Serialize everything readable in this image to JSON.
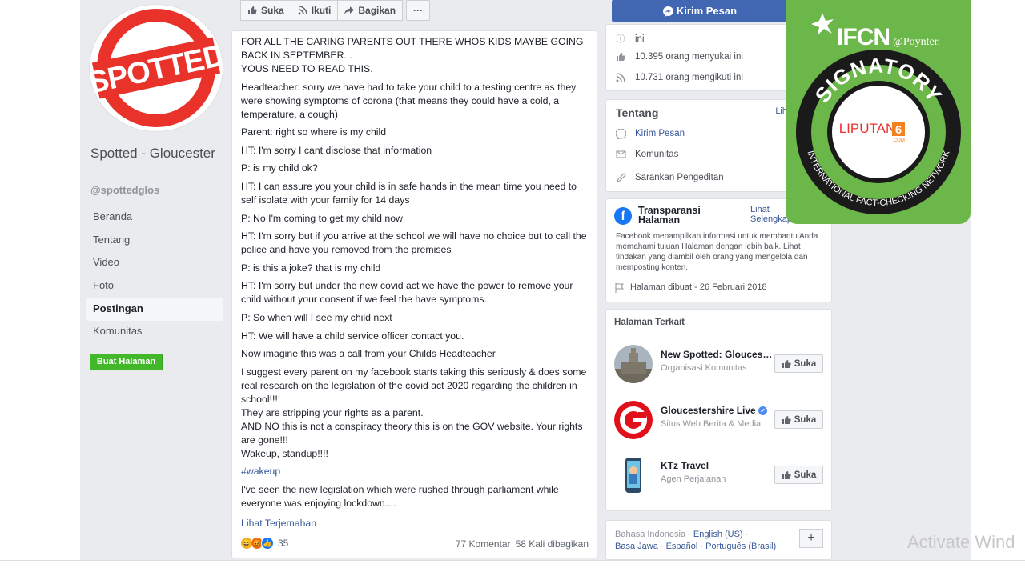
{
  "page": {
    "name": "Spotted - Gloucester",
    "handle": "@spottedglos",
    "logo_text": "SPOTTED",
    "create_page_label": "Buat Halaman"
  },
  "nav": [
    {
      "label": "Beranda",
      "active": false
    },
    {
      "label": "Tentang",
      "active": false
    },
    {
      "label": "Video",
      "active": false
    },
    {
      "label": "Foto",
      "active": false
    },
    {
      "label": "Postingan",
      "active": true
    },
    {
      "label": "Komunitas",
      "active": false
    }
  ],
  "actions": {
    "like": "Suka",
    "follow": "Ikuti",
    "share": "Bagikan",
    "more": "···"
  },
  "post": {
    "paragraphs": [
      "FOR ALL THE CARING PARENTS OUT THERE WHOS KIDS MAYBE GOING BACK IN SEPTEMBER...\nYOUS NEED TO READ THIS.",
      "Headteacher: sorry we have had to take your child to a testing centre as they were showing symptoms of corona (that means they could have a cold, a temperature, a cough)",
      "Parent: right so where is my child",
      "HT: I'm sorry I cant disclose that information",
      "P: is my child ok?",
      "HT: I can assure you your child is in safe hands in the mean time you need to self isolate with your family for 14 days",
      "P: No I'm coming to get my child now",
      "HT: I'm sorry but if you arrive at the school we will have no choice but to call the police and have you removed from the premises",
      "P: is this a joke? that is my child",
      "HT: I'm sorry but under the new covid act we have the power to remove your child without your consent if we feel the have symptoms.",
      "P: So when will I see my child next",
      "HT: We will have a child service officer contact you.",
      "Now imagine this was a call from your Childs Headteacher",
      "I suggest every parent on my facebook starts taking this seriously & does some real research on the legislation of the covid act 2020 regarding the children in school!!!!\nThey are stripping your rights as a parent.\nAND NO this is not a conspiracy theory this is on the GOV website. Your rights are gone!!!\nWakeup, standup!!!!"
    ],
    "hashtag": "#wakeup",
    "after_hashtag": "I've seen the new legislation which were rushed through parliament while everyone was enjoying lockdown....",
    "translate_label": "Lihat Terjemahan",
    "reaction_count": "35",
    "comments": "77 Komentar",
    "shares": "58 Kali dibagikan"
  },
  "sidebar": {
    "message_button": "Kirim Pesan",
    "stats": [
      {
        "icon": "info-icon",
        "text": "ini"
      },
      {
        "icon": "thumbs-up-icon",
        "text": "10.395 orang menyukai ini"
      },
      {
        "icon": "rss-icon",
        "text": "10.731 orang mengikuti ini"
      }
    ],
    "about": {
      "title": "Tentang",
      "see_all": "Lih",
      "items": [
        {
          "icon": "messenger-icon",
          "text": "Kirim Pesan",
          "link": true
        },
        {
          "icon": "community-icon",
          "text": "Komunitas",
          "link": false
        },
        {
          "icon": "pencil-icon",
          "text": "Sarankan Pengeditan",
          "link": false
        }
      ]
    },
    "transparency": {
      "title": "Transparansi Halaman",
      "see_more": "Lihat Selengkapnya",
      "description": "Facebook menampilkan informasi untuk membantu Anda memahami tujuan Halaman dengan lebih baik. Lihat tindakan yang diambil oleh orang yang mengelola dan memposting konten.",
      "created": "Halaman dibuat - 26 Februari 2018"
    },
    "related": {
      "title": "Halaman Terkait",
      "items": [
        {
          "name": "New Spotted: Gloucester",
          "category": "Organisasi Komunitas",
          "like": "Suka",
          "verified": false,
          "thumb": "church-thumb"
        },
        {
          "name": "Gloucestershire Live",
          "category": "Situs Web Berita & Media",
          "like": "Suka",
          "verified": true,
          "thumb": "g-logo-thumb"
        },
        {
          "name": "KTz Travel",
          "category": "Agen Perjalanan",
          "like": "Suka",
          "verified": false,
          "thumb": "phone-thumb"
        }
      ]
    },
    "languages": {
      "current": "Bahasa Indonesia",
      "options": [
        "English (US)",
        "Basa Jawa",
        "Español",
        "Português (Brasil)"
      ],
      "add": "+"
    }
  },
  "badge": {
    "ifcn": "IFCN",
    "poynter": "@Poynter.",
    "signatory": "SIGNATORY",
    "network": "INTERNATIONAL FACT-CHECKING NETWORK",
    "partner": "LIPUTAN",
    "partner_num": "6",
    "partner_domain": ".COM"
  },
  "watermark": "Activate Wind",
  "colors": {
    "fb_blue": "#4267b2",
    "link": "#385898",
    "green": "#42b72a",
    "ifcn_green": "#6cb749",
    "spotted_red": "#e8322a"
  }
}
